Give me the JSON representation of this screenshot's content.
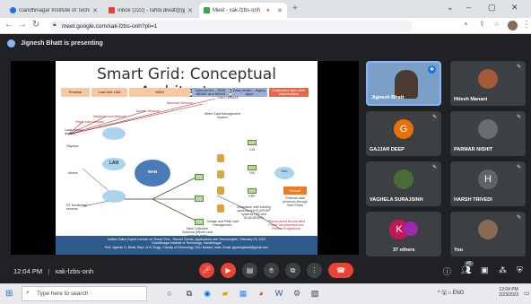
{
  "browser": {
    "tabs": [
      {
        "title": "Gandhinagar Institute of Techno",
        "favicon_color": "#1a73e8"
      },
      {
        "title": "Inbox (222) - rahdi.diwat@gji",
        "favicon_color": "#ea4335"
      },
      {
        "title": "Meet - xak-fzbs-onh",
        "favicon_color": "#34a853"
      }
    ],
    "new_tab": "+",
    "address": "meet.google.com/xak-fzbs-onh?pli=1",
    "window_controls": [
      "⌄",
      "–",
      "▢",
      "✕"
    ]
  },
  "meet": {
    "presenting_text": "Jignesh Bhatt is presenting",
    "slide": {
      "title": "Smart Grid: Conceptual Architecture",
      "headers": [
        "Premise",
        "Last mile LAN",
        "WAN",
        "Data center – RMS, MDMS and MDAS",
        "Data center – legacy apps",
        "Customers and other stakeholders"
      ],
      "network_labels": [
        "Office Network",
        "Backhaul Network",
        "Access Network",
        "Neighborhood Network",
        "Home Area Network"
      ],
      "node_labels": [
        "Load control devices",
        "Displays",
        "Meters",
        "DT Monitoring sensors",
        "LAN",
        "WAN",
        "Data Collection Systems (Meters and sensors data)",
        "Meter Data Management System",
        "Outage and Peak load management",
        "CIS",
        "GIS",
        "ERP",
        "Integration with existing systems and R-APDRP systems (ITA and SCADA/DMS)",
        "Web",
        "Firewall",
        "External data provision through Web Portal"
      ],
      "note": "*Restructured Accelerated Power Development and Reform Programme",
      "footer_lines": [
        "Invited Online Expert Lecture on \"Smart Grid – Recent Trends, Applications and Technologies\", February 23, 2022",
        "Gandhinagar Institute of Technology, Gandhinagar",
        "Prof. Jignesh G. Bhatt, Dept. of IC Engg., Faculty of Technology, DDU Nadiad, India. Email: jigneshgbhatt@gmail.com"
      ]
    },
    "participants": [
      {
        "name": "Jignesh Bhatt",
        "color": "#7aa0c8",
        "kind": "video"
      },
      {
        "name": "Hitesh Manani",
        "color": "#a05a3a",
        "kind": "photo"
      },
      {
        "name": "GAJJAR DEEP",
        "initial": "G",
        "color": "#e8710a",
        "kind": "initial"
      },
      {
        "name": "PARMAR NISHIT",
        "color": "#6b6b6b",
        "kind": "photo"
      },
      {
        "name": "VAGHELA SURAJSINH",
        "color": "#4a6b3a",
        "kind": "photo"
      },
      {
        "name": "HARSH TRIVEDI",
        "initial": "H",
        "color": "#5f6368",
        "kind": "initial"
      },
      {
        "name": "37 others",
        "initial": "K",
        "color": "#c2185b",
        "kind": "initial"
      },
      {
        "name": "You",
        "color": "#8a6a50",
        "kind": "photo"
      }
    ],
    "clock": "12:04 PM",
    "meeting_code": "xak-fzbs-onh",
    "participant_count": "45",
    "control_icons": [
      "mic-off",
      "camera-off",
      "captions",
      "raise-hand",
      "present",
      "more",
      "end-call"
    ],
    "right_icons": [
      "info",
      "people",
      "chat",
      "activities",
      "host-controls"
    ]
  },
  "taskbar": {
    "search_placeholder": "Type here to search",
    "apps": [
      "task-view",
      "edge",
      "file-explorer",
      "store",
      "chrome",
      "word",
      "settings",
      "photos"
    ],
    "tray": "^ 🖫 ⌂ ENG",
    "time": "12:04 PM",
    "date": "2/23/2022"
  },
  "colors": {
    "meet_bg": "#202124",
    "tile_bg": "#3c4043",
    "end_call": "#ea4335",
    "active_speaker_border": "#8ab4f8"
  }
}
